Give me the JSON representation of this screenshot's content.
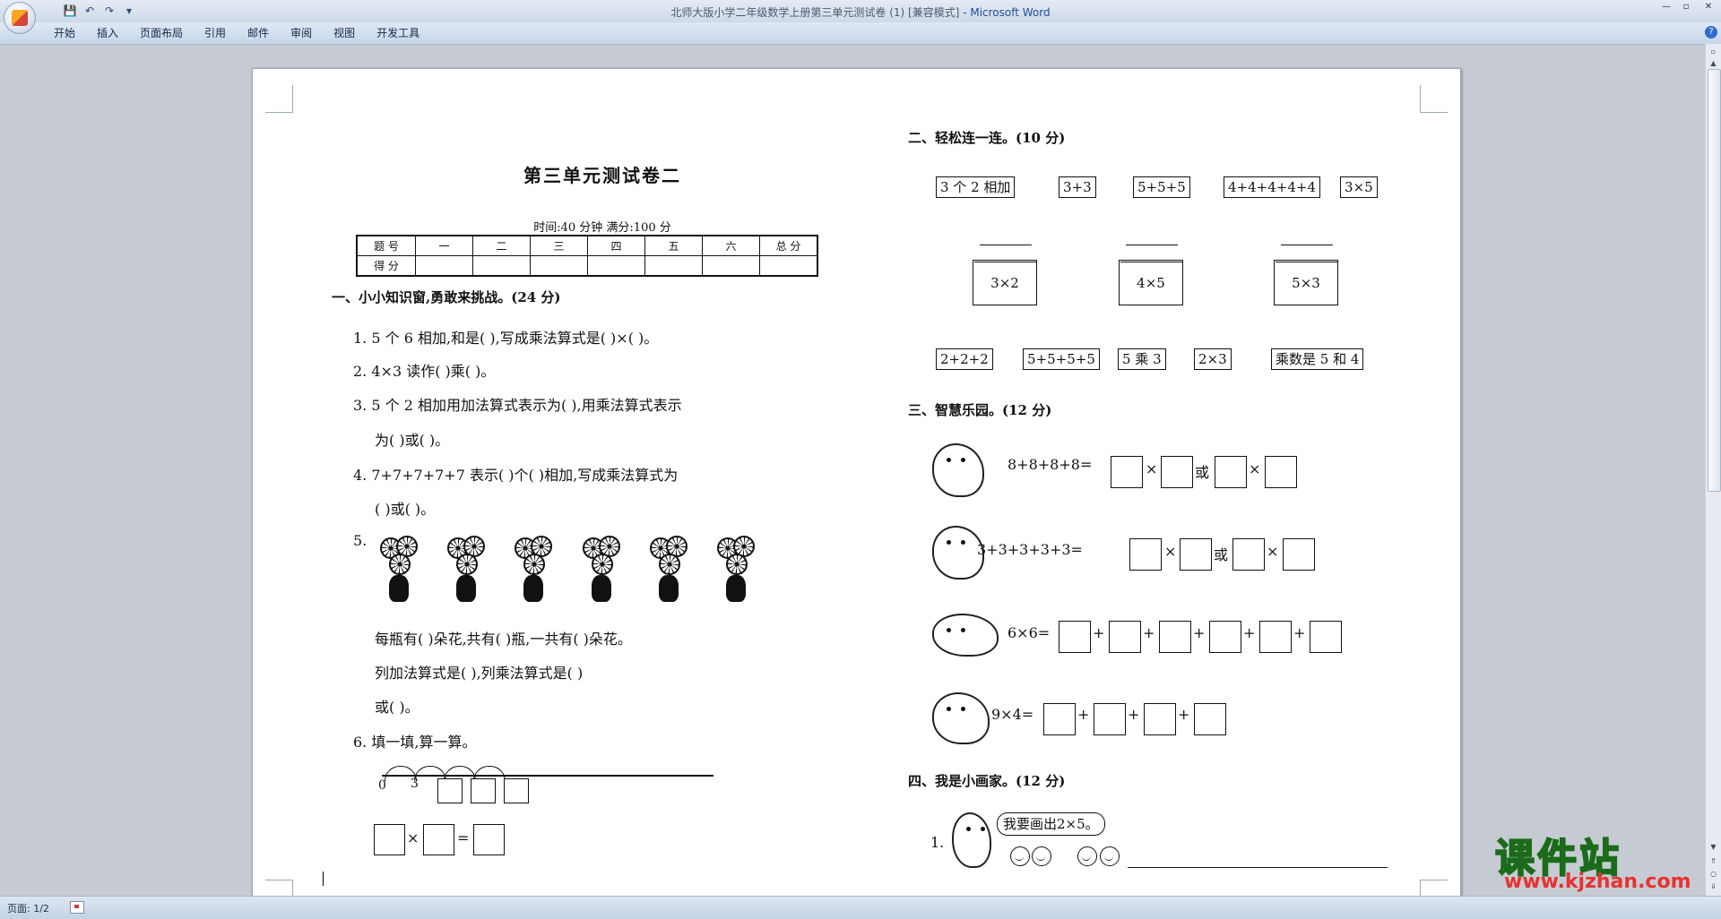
{
  "window": {
    "title": "北师大版小学二年级数学上册第三单元测试卷 (1) [兼容模式]",
    "app_name": " - Microsoft Word",
    "controls": [
      "—",
      "▫",
      "✕"
    ]
  },
  "qat": {
    "save": "💾",
    "undo": "↶",
    "redo": "↷",
    "more": "▾"
  },
  "ribbon": {
    "tabs": [
      "开始",
      "插入",
      "页面布局",
      "引用",
      "邮件",
      "审阅",
      "视图",
      "开发工具"
    ],
    "help": "?"
  },
  "status": {
    "page": "页面: 1/2"
  },
  "doc": {
    "title": "第三单元测试卷二",
    "meta": "时间:40 分钟    满分:100 分",
    "table": {
      "row1": [
        "题 号",
        "一",
        "二",
        "三",
        "四",
        "五",
        "六",
        "总 分"
      ],
      "row2": [
        "得 分",
        "",
        "",
        "",
        "",
        "",
        "",
        ""
      ]
    },
    "sec1": {
      "head": "一、小小知识窗,勇敢来挑战。(24 分)",
      "q1": "1. 5 个 6 相加,和是(         ),写成乘法算式是(         )×(         )。",
      "q2": "2. 4×3 读作(         )乘(         )。",
      "q3a": "3. 5 个 2 相加用加法算式表示为(                    ),用乘法算式表示",
      "q3b": "为(                 )或(                 )。",
      "q4a": "4. 7+7+7+7+7 表示(         )个(         )相加,写成乘法算式为",
      "q4b": "(                 )或(                 )。",
      "q5": "5.",
      "q5a": "每瓶有(         )朵花,共有(         )瓶,一共有(         )朵花。",
      "q5b": "列加法算式是(                  ),列乘法算式是(                     )",
      "q5c": "或(                        )。",
      "q6": "6. 填一填,算一算。",
      "nl0": "0",
      "nl3": "3",
      "times": "×",
      "equals": "="
    },
    "sec2": {
      "head": "二、轻松连一连。(10 分)",
      "top": [
        "3 个 2 相加",
        "3+3",
        "5+5+5",
        "4+4+4+4+4",
        "3×5"
      ],
      "houses": [
        "3×2",
        "4×5",
        "5×3"
      ],
      "bottom": [
        "2+2+2",
        "5+5+5+5",
        "5 乘 3",
        "2×3",
        "乘数是 5 和 4"
      ]
    },
    "sec3": {
      "head": "三、智慧乐园。(12 分)",
      "r1": "8+8+8+8=",
      "r2": "3+3+3+3+3=",
      "r3": "6×6=",
      "r4": "9×4=",
      "or": "或",
      "times": "×",
      "plus": "+"
    },
    "sec4": {
      "head": "四、我是小画家。(12 分)",
      "n1": "1.",
      "bubble": "我要画出2×5。"
    }
  },
  "watermark": {
    "main": "课件站",
    "url": "www.kjzhan.com"
  }
}
